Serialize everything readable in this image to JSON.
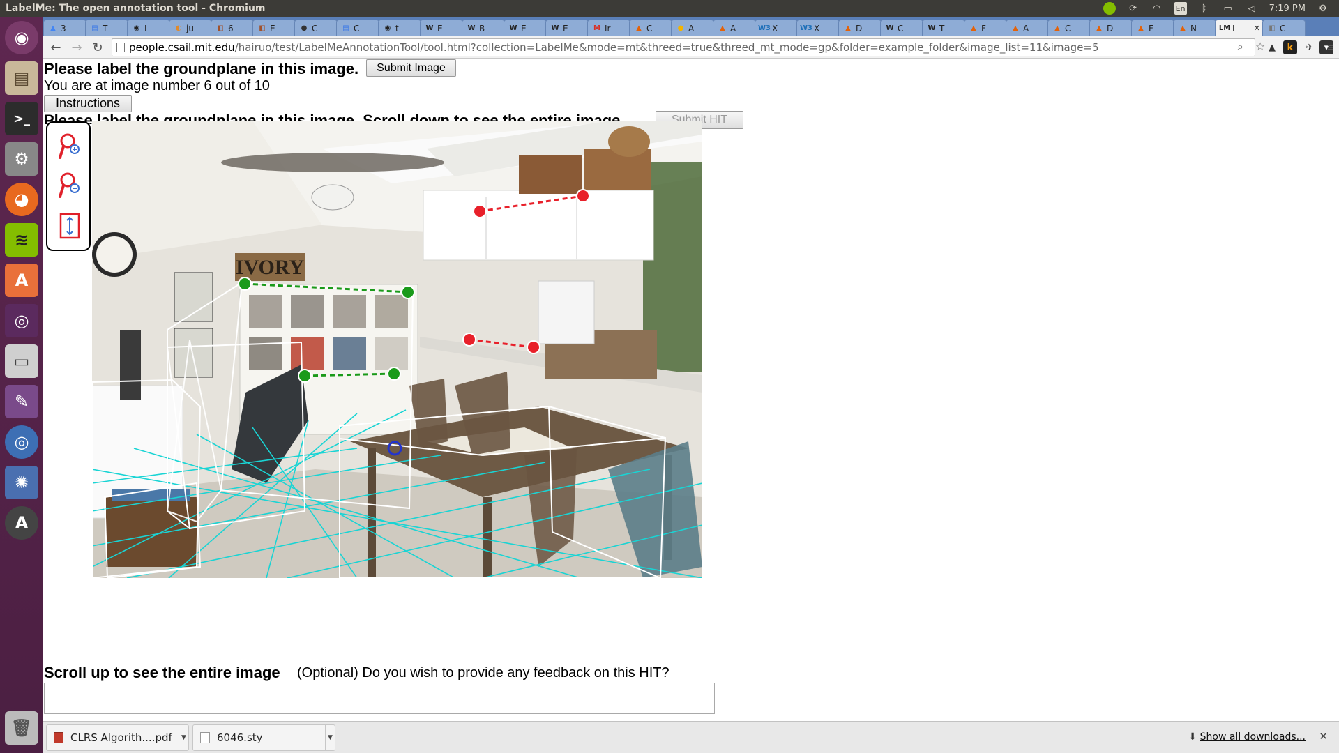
{
  "window": {
    "title": "LabelMe: The open annotation tool - Chromium",
    "clock": "7:19 PM",
    "keyboard": "En"
  },
  "tabs": [
    {
      "label": "3",
      "fav": "▲",
      "color": "#4285f4"
    },
    {
      "label": "T",
      "fav": "▤",
      "color": "#3b78e7"
    },
    {
      "label": "L",
      "fav": "◉",
      "color": "#222222"
    },
    {
      "label": "ju",
      "fav": "◐",
      "color": "#e08a2c"
    },
    {
      "label": "6",
      "fav": "◧",
      "color": "#a0522d"
    },
    {
      "label": "E",
      "fav": "◧",
      "color": "#a0522d"
    },
    {
      "label": "C",
      "fav": "●",
      "color": "#333333"
    },
    {
      "label": "C",
      "fav": "▤",
      "color": "#3b78e7"
    },
    {
      "label": "t",
      "fav": "◉",
      "color": "#222222"
    },
    {
      "label": "E",
      "fav": "W",
      "color": "#222222"
    },
    {
      "label": "B",
      "fav": "W",
      "color": "#222222"
    },
    {
      "label": "E",
      "fav": "W",
      "color": "#222222"
    },
    {
      "label": "E",
      "fav": "W",
      "color": "#222222"
    },
    {
      "label": "Ir",
      "fav": "M",
      "color": "#d93025"
    },
    {
      "label": "C",
      "fav": "▲",
      "color": "#e36209"
    },
    {
      "label": "A",
      "fav": "●",
      "color": "#f4b400"
    },
    {
      "label": "A",
      "fav": "▲",
      "color": "#e36209"
    },
    {
      "label": "X",
      "fav": "W3",
      "color": "#1e6fb8"
    },
    {
      "label": "X",
      "fav": "W3",
      "color": "#1e6fb8"
    },
    {
      "label": "D",
      "fav": "▲",
      "color": "#e36209"
    },
    {
      "label": "C",
      "fav": "W",
      "color": "#222222"
    },
    {
      "label": "T",
      "fav": "W",
      "color": "#222222"
    },
    {
      "label": "F",
      "fav": "▲",
      "color": "#e36209"
    },
    {
      "label": "A",
      "fav": "▲",
      "color": "#e36209"
    },
    {
      "label": "C",
      "fav": "▲",
      "color": "#e36209"
    },
    {
      "label": "D",
      "fav": "▲",
      "color": "#e36209"
    },
    {
      "label": "F",
      "fav": "▲",
      "color": "#e36209"
    },
    {
      "label": "N",
      "fav": "▲",
      "color": "#e36209"
    },
    {
      "label": "L",
      "fav": "LM",
      "color": "#222222",
      "active": true
    },
    {
      "label": "C",
      "fav": "◧",
      "color": "#777777"
    }
  ],
  "address": {
    "host": "people.csail.mit.edu",
    "path": "/hairuo/test/LabelMeAnnotationTool/tool.html?collection=LabelMe&mode=mt&threed=true&threed_mt_mode=gp&folder=example_folder&image_list=11&image=5"
  },
  "page": {
    "heading": "Please label the groundplane in this image.",
    "submit_image": "Submit Image",
    "image_count": "You are at image number 6 out of 10",
    "instructions": "Instructions",
    "heading2": "Please label the groundplane in this image. Scroll down to see the entire image.",
    "submit_hit": "Submit HIT",
    "scroll_label": "Scroll up to see the entire image",
    "feedback_question": "(Optional) Do you wish to provide any feedback on this HIT?",
    "feedback_value": ""
  },
  "scene": {
    "sign_text": "IVORY",
    "colors": {
      "groundplane": "#19d4d4",
      "box": "#ffffff",
      "red_handle": "#e8202a",
      "green_handle": "#1a9a1a",
      "blue_handle": "#2233cc"
    }
  },
  "downloads": {
    "items": [
      {
        "name": "CLRS Algorith....pdf",
        "type": "pdf"
      },
      {
        "name": "6046.sty",
        "type": "file"
      }
    ],
    "show_all": "Show all downloads..."
  }
}
